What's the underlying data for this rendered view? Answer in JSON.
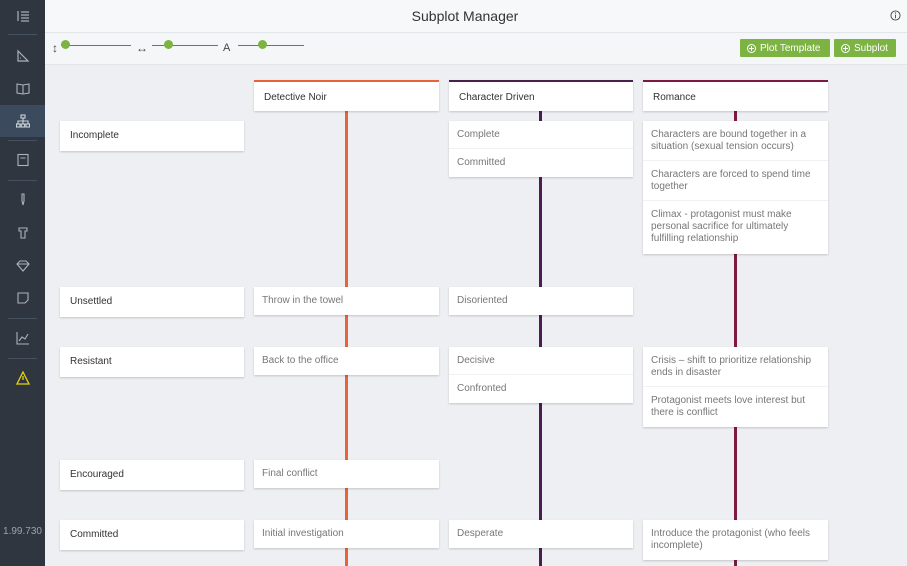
{
  "app": {
    "title": "Subplot Manager",
    "version": "1.99.730"
  },
  "sidebar": {
    "items": [
      {
        "icon": "outline-list-icon"
      },
      {
        "icon": "ruler-icon"
      },
      {
        "icon": "book-icon"
      },
      {
        "icon": "hierarchy-icon",
        "active": true
      },
      {
        "icon": "notebook-icon"
      },
      {
        "icon": "pen-icon"
      },
      {
        "icon": "castle-icon"
      },
      {
        "icon": "gem-icon"
      },
      {
        "icon": "note-icon"
      },
      {
        "icon": "chart-icon"
      },
      {
        "icon": "warning-icon"
      }
    ]
  },
  "toolbar": {
    "height_icon": "↕",
    "width_icon": "↔",
    "font_icon": "A",
    "plot_template_label": "Plot Template",
    "subplot_label": "Subplot"
  },
  "colors": {
    "accent": "#7cb342",
    "detective_noir": "#e8623a",
    "character_driven": "#4a1e4f",
    "romance": "#7d1a43"
  },
  "columns": [
    {
      "name": "Detective Noir"
    },
    {
      "name": "Character Driven"
    },
    {
      "name": "Romance"
    }
  ],
  "rows": [
    {
      "name": "Incomplete"
    },
    {
      "name": "Unsettled"
    },
    {
      "name": "Resistant"
    },
    {
      "name": "Encouraged"
    },
    {
      "name": "Committed"
    }
  ],
  "cells": {
    "cd_incomplete": [
      "Complete",
      "Committed"
    ],
    "ro_incomplete": [
      "Characters are bound together in a situation (sexual tension occurs)",
      "Characters are forced to spend time together",
      "Climax - protagonist must make personal sacrifice for ultimately fulfilling relationship"
    ],
    "dn_unsettled": [
      "Throw in the towel"
    ],
    "cd_unsettled": [
      "Disoriented"
    ],
    "dn_resistant": [
      "Back to the office"
    ],
    "cd_resistant": [
      "Decisive",
      "Confronted"
    ],
    "ro_resistant": [
      "Crisis – shift to prioritize relationship ends in disaster",
      "Protagonist meets love interest but there is conflict"
    ],
    "dn_encouraged": [
      "Final conflict"
    ],
    "dn_committed": [
      "Initial investigation"
    ],
    "cd_committed": [
      "Desperate"
    ],
    "ro_committed": [
      "Introduce the protagonist (who feels incomplete)"
    ]
  }
}
